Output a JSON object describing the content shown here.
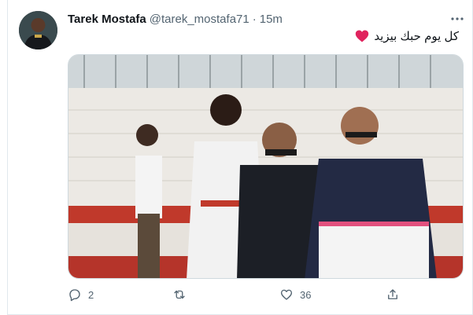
{
  "tweet": {
    "author_name": "Tarek Mostafa",
    "author_handle": "@tarek_mostafa71",
    "separator": "·",
    "time": "15m",
    "text": "كل يوم حبك بيزيد"
  },
  "icons": {
    "more": "more-horizontal-icon",
    "emoji": "red-heart-emoji",
    "reply": "reply-icon",
    "retweet": "retweet-icon",
    "like": "heart-icon",
    "share": "share-icon"
  },
  "stats": {
    "replies": "2",
    "likes": "36"
  },
  "colors": {
    "heart_emoji": "#e0245e",
    "secondary_text": "#536471"
  }
}
